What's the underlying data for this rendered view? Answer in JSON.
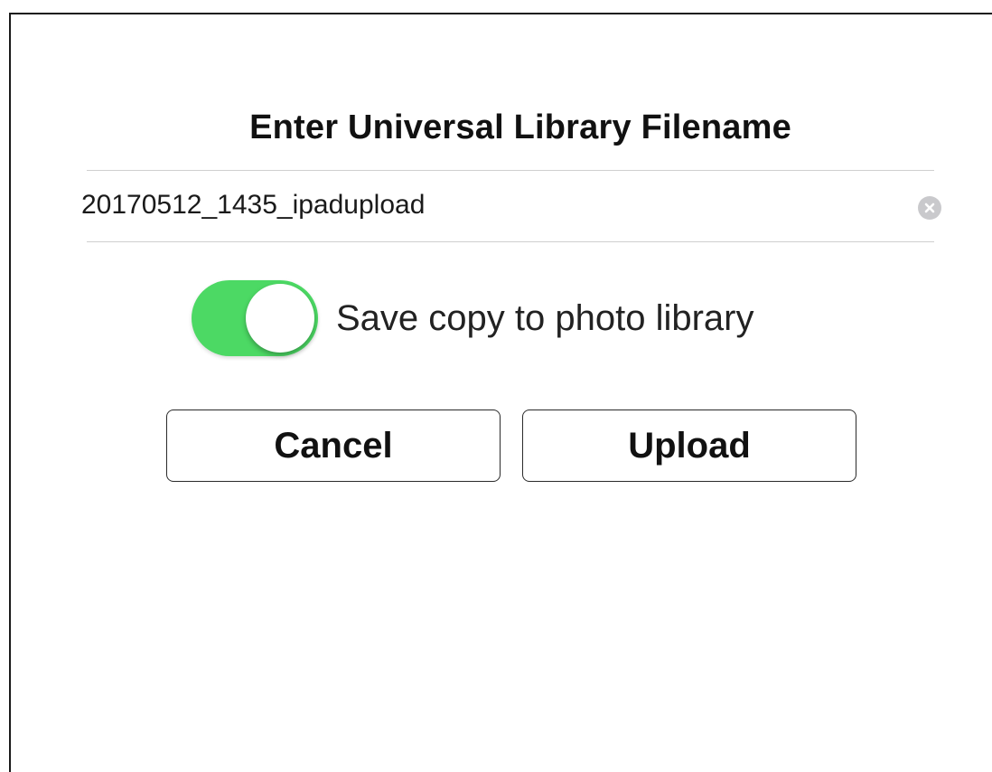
{
  "dialog": {
    "title": "Enter Universal Library Filename",
    "filename_field": {
      "value": "20170512_1435_ipadupload",
      "clear_icon": "clear-circle-icon"
    },
    "save_copy_toggle": {
      "label": "Save copy to photo library",
      "on": true,
      "on_color": "#4cd964"
    },
    "buttons": {
      "cancel_label": "Cancel",
      "upload_label": "Upload"
    }
  }
}
